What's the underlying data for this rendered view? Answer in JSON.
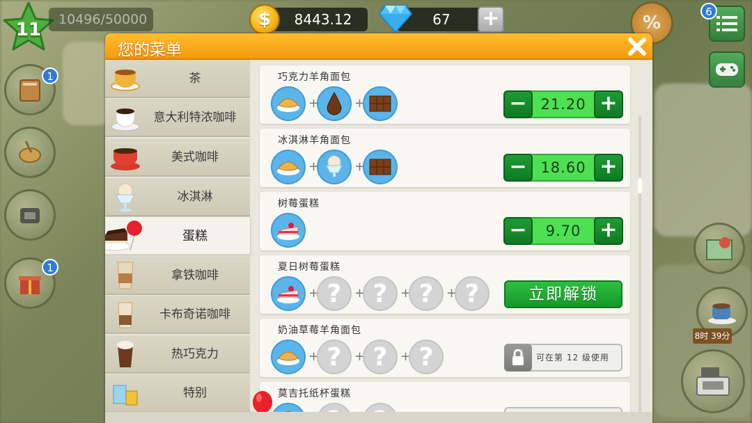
{
  "hud": {
    "level": "11",
    "xp": "10496/50000",
    "coins": "8443.12",
    "gems": "67",
    "add_gems": "+"
  },
  "side": {
    "left_badge_1": "1",
    "left_badge_2": "1",
    "right_badge": "6",
    "timer": "8时 39分"
  },
  "dialog": {
    "title": "您的菜单",
    "close": "✕"
  },
  "menu": [
    {
      "label": "茶",
      "icon": "tea-icon"
    },
    {
      "label": "意大利特浓咖啡",
      "icon": "espresso-icon"
    },
    {
      "label": "美式咖啡",
      "icon": "americano-icon"
    },
    {
      "label": "冰淇淋",
      "icon": "ice-cream-icon"
    },
    {
      "label": "蛋糕",
      "icon": "cake-icon",
      "active": true
    },
    {
      "label": "拿铁咖啡",
      "icon": "latte-icon"
    },
    {
      "label": "卡布奇诺咖啡",
      "icon": "cappuccino-icon"
    },
    {
      "label": "热巧克力",
      "icon": "hot-chocolate-icon"
    },
    {
      "label": "特别",
      "icon": "special-icon"
    }
  ],
  "recipes": [
    {
      "name": "巧克力羊角面包",
      "ingredients": [
        "croissant-icon",
        "chocolate-drop-icon",
        "chocolate-bar-icon"
      ],
      "price": "21.20",
      "minus": "−",
      "plus": "+"
    },
    {
      "name": "冰淇淋羊角面包",
      "ingredients": [
        "croissant-icon",
        "ice-cream-icon",
        "chocolate-bar-icon"
      ],
      "price": "18.60",
      "minus": "−",
      "plus": "+"
    },
    {
      "name": "树莓蛋糕",
      "ingredients": [
        "raspberry-cake-icon"
      ],
      "price": "9.70",
      "minus": "−",
      "plus": "+"
    },
    {
      "name": "夏日树莓蛋糕",
      "ingredients": [
        "raspberry-cake-icon",
        "?",
        "?",
        "?",
        "?"
      ],
      "unlock": "立即解锁"
    },
    {
      "name": "奶油草莓羊角面包",
      "ingredients": [
        "croissant-icon",
        "?",
        "?",
        "?"
      ],
      "lock_text": "可在第 12 级使用"
    },
    {
      "name": "莫吉托纸杯蛋糕",
      "ingredients": [
        "cupcake-icon",
        "?",
        "?"
      ]
    }
  ],
  "question_mark": "?",
  "plus_join": "+"
}
